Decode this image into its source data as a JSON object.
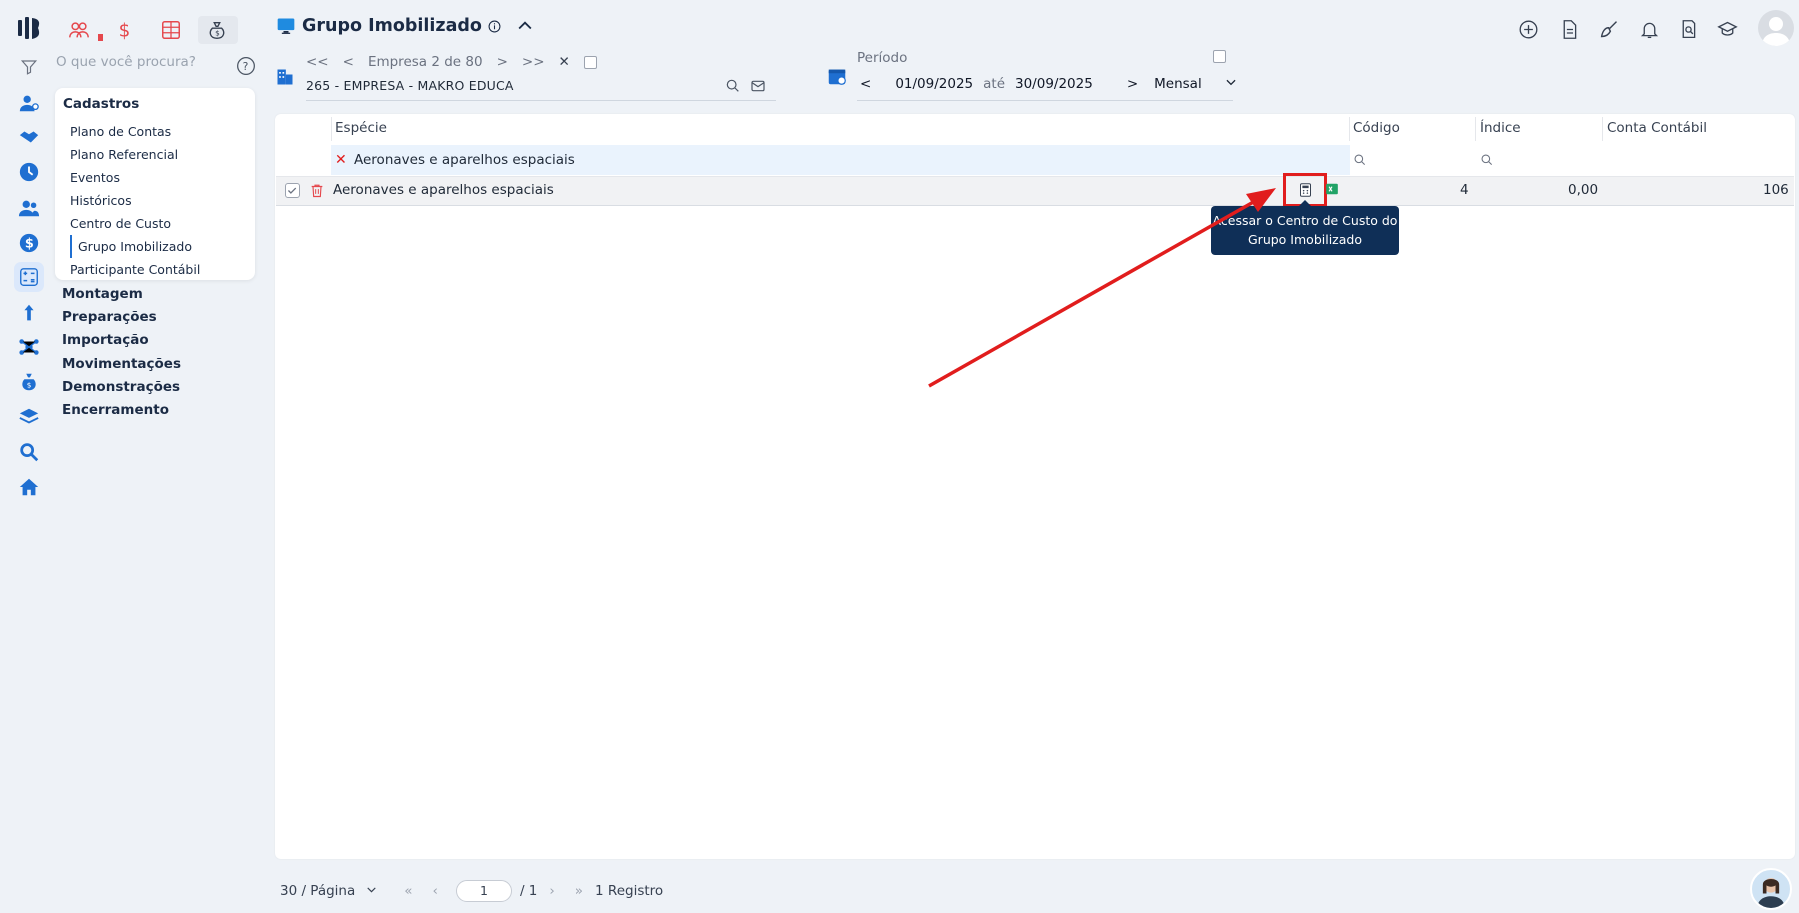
{
  "app": {
    "search_placeholder": "O que você procura?"
  },
  "menu": {
    "title": "Cadastros",
    "items": [
      "Plano de Contas",
      "Plano Referencial",
      "Eventos",
      "Históricos",
      "Centro de Custo",
      "Grupo Imobilizado",
      "Participante Contábil"
    ],
    "sections": [
      "Montagem",
      "Preparações",
      "Importação",
      "Movimentações",
      "Demonstrações",
      "Encerramento"
    ]
  },
  "header": {
    "title": "Grupo Imobilizado"
  },
  "company": {
    "nav_text": "Empresa 2 de 80",
    "name": "265 - EMPRESA - MAKRO EDUCA"
  },
  "period": {
    "label": "Período",
    "start": "01/09/2025",
    "sep": "até",
    "end": "30/09/2025",
    "type": "Mensal"
  },
  "table": {
    "columns": [
      "Espécie",
      "Código",
      "Índice",
      "Conta Contábil"
    ],
    "filter_value": "Aeronaves e aparelhos espaciais",
    "rows": [
      {
        "especie": "Aeronaves e aparelhos espaciais",
        "codigo": "4",
        "indice": "0,00",
        "conta": "106"
      }
    ]
  },
  "tooltip": {
    "line1": "Acessar o Centro de Custo do",
    "line2": "Grupo Imobilizado"
  },
  "footer": {
    "per_page": "30 / Página",
    "page": "1",
    "total_pages": "/ 1",
    "records": "1 Registro"
  },
  "colors": {
    "accent": "#1f6fd1",
    "highlight_red": "#e11d1d",
    "tooltip_bg": "#0f2f57"
  }
}
